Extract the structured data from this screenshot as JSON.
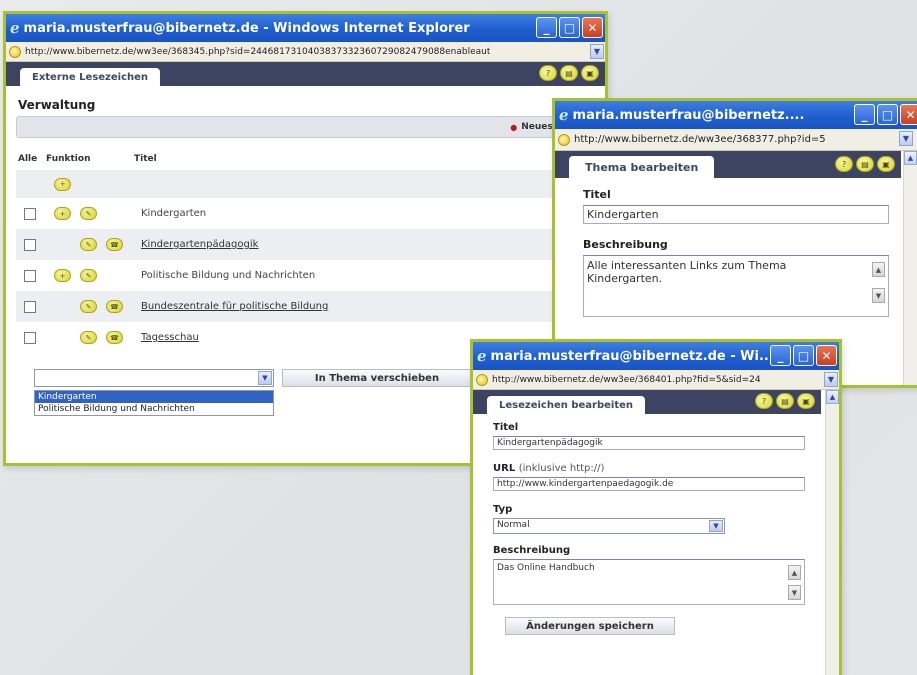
{
  "window1": {
    "title": "maria.musterfrau@bibernetz.de - Windows Internet Explorer",
    "url": "http://www.bibernetz.de/ww3ee/368345.php?sid=2446817310403837332360729082479088enableaut",
    "tab": "Externe Lesezeichen",
    "heading": "Verwaltung",
    "new_theme_label": "Neues Thema",
    "columns": {
      "all": "Alle",
      "function": "Funktion",
      "title": "Titel"
    },
    "rows": [
      {
        "label": "",
        "link": false,
        "indent": false,
        "checkbox": false
      },
      {
        "label": "Kindergarten",
        "link": false,
        "indent": false,
        "checkbox": true
      },
      {
        "label": "Kindergartenpädagogik",
        "link": true,
        "indent": true,
        "checkbox": true
      },
      {
        "label": "Politische Bildung und Nachrichten",
        "link": false,
        "indent": false,
        "checkbox": true
      },
      {
        "label": "Bundeszentrale für politische Bildung",
        "link": true,
        "indent": true,
        "checkbox": true
      },
      {
        "label": "Tagesschau",
        "link": true,
        "indent": true,
        "checkbox": true
      }
    ],
    "select_value": "",
    "move_button": "In Thema verschieben",
    "dropdown_options": [
      {
        "label": "Kindergarten",
        "selected": true
      },
      {
        "label": "Politische Bildung und Nachrichten",
        "selected": false
      }
    ]
  },
  "window2": {
    "title": "maria.musterfrau@bibernetz....",
    "url": "http://www.bibernetz.de/ww3ee/368377.php?id=5",
    "tab": "Thema bearbeiten",
    "title_label": "Titel",
    "title_value": "Kindergarten",
    "desc_label": "Beschreibung",
    "desc_value": "Alle interessanten Links zum Thema Kindergarten."
  },
  "window3": {
    "title": "maria.musterfrau@bibernetz.de - Wi...",
    "url": "http://www.bibernetz.de/ww3ee/368401.php?fid=5&sid=24",
    "tab": "Lesezeichen bearbeiten",
    "title_label": "Titel",
    "title_value": "Kindergartenpädagogik",
    "url_label": "URL",
    "url_hint": "(inklusive http://)",
    "url_value": "http://www.kindergartenpaedagogik.de",
    "type_label": "Typ",
    "type_value": "Normal",
    "desc_label": "Beschreibung",
    "desc_value": "Das Online Handbuch",
    "save_button": "Änderungen speichern"
  },
  "colors": {
    "frame_green": "#a7c22d",
    "titlebar_blue": "#1f5ecf",
    "tabstrip": "#3c4462",
    "icon_yellow": "#d7d42c",
    "selection_blue": "#3163c5"
  }
}
